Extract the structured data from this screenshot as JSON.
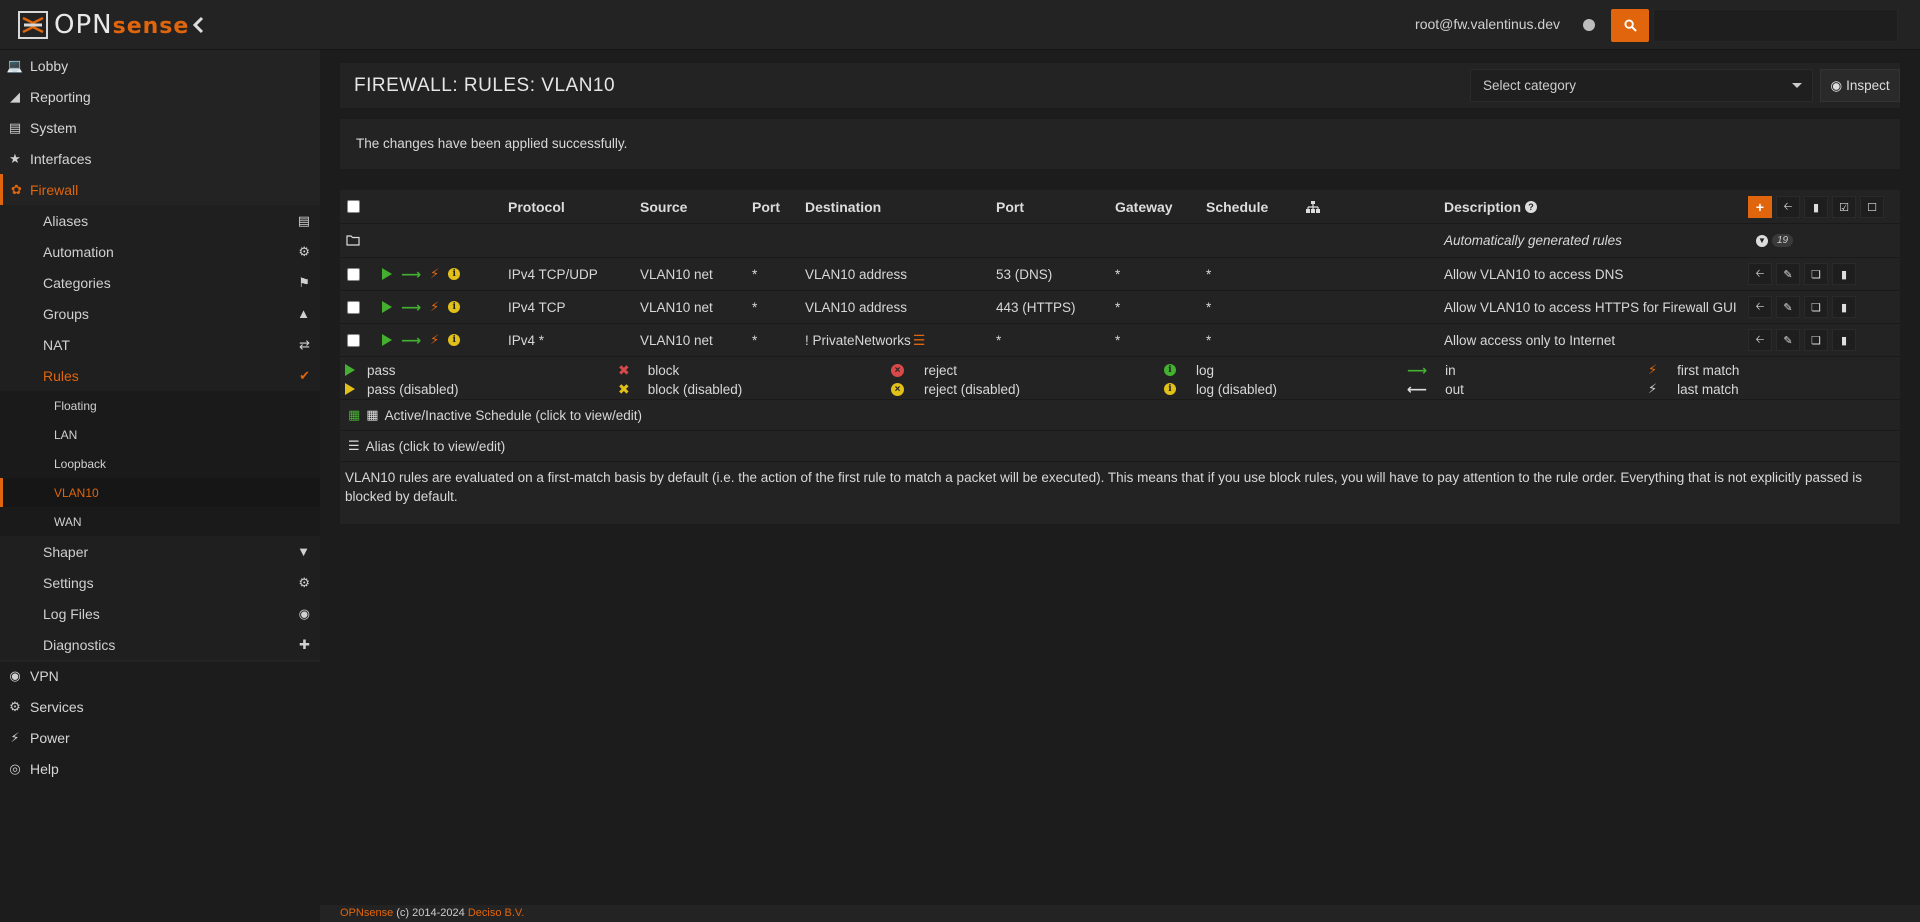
{
  "topbar": {
    "logo_main": "OPN",
    "logo_sub": "sense",
    "user": "root@fw.valentinus.dev",
    "search_placeholder": ""
  },
  "sidebar": {
    "items": [
      {
        "label": "Lobby",
        "icon": "laptop-icon"
      },
      {
        "label": "Reporting",
        "icon": "chart-area-icon"
      },
      {
        "label": "System",
        "icon": "server-icon"
      },
      {
        "label": "Interfaces",
        "icon": "sitemap-icon"
      },
      {
        "label": "Firewall",
        "icon": "fire-icon"
      }
    ],
    "firewall_sub": [
      {
        "label": "Aliases",
        "icon": "list-alt-icon"
      },
      {
        "label": "Automation",
        "icon": "cog-icon"
      },
      {
        "label": "Categories",
        "icon": "tags-icon"
      },
      {
        "label": "Groups",
        "icon": "sitemap-icon"
      },
      {
        "label": "NAT",
        "icon": "exchange-icon"
      },
      {
        "label": "Rules",
        "icon": "check-icon"
      }
    ],
    "rules_sub": [
      "Floating",
      "LAN",
      "Loopback",
      "VLAN10",
      "WAN"
    ],
    "firewall_sub2": [
      {
        "label": "Shaper",
        "icon": "filter-icon"
      },
      {
        "label": "Settings",
        "icon": "cogs-icon"
      },
      {
        "label": "Log Files",
        "icon": "eye-icon"
      },
      {
        "label": "Diagnostics",
        "icon": "medkit-icon"
      }
    ],
    "items2": [
      {
        "label": "VPN",
        "icon": "globe-icon"
      },
      {
        "label": "Services",
        "icon": "cog-icon"
      },
      {
        "label": "Power",
        "icon": "plug-icon"
      },
      {
        "label": "Help",
        "icon": "life-ring-icon"
      }
    ]
  },
  "main": {
    "title": "FIREWALL: RULES: VLAN10",
    "select_category": "Select category",
    "inspect": "Inspect",
    "alert": "The changes have been applied successfully."
  },
  "table": {
    "headers": {
      "protocol": "Protocol",
      "source": "Source",
      "port": "Port",
      "destination": "Destination",
      "dport": "Port",
      "gateway": "Gateway",
      "schedule": "Schedule",
      "description": "Description"
    },
    "auto_rules": {
      "label": "Automatically generated rules",
      "count": "19"
    },
    "rows": [
      {
        "protocol": "IPv4 TCP/UDP",
        "source": "VLAN10 net",
        "port": "*",
        "destination": "VLAN10 address",
        "dport": "53 (DNS)",
        "gateway": "*",
        "schedule": "*",
        "description": "Allow VLAN10 to access DNS"
      },
      {
        "protocol": "IPv4 TCP",
        "source": "VLAN10 net",
        "port": "*",
        "destination": "VLAN10 address",
        "dport": "443 (HTTPS)",
        "gateway": "*",
        "schedule": "*",
        "description": "Allow VLAN10 to access HTTPS for Firewall GUI"
      },
      {
        "protocol": "IPv4 *",
        "source": "VLAN10 net",
        "port": "*",
        "destination": "! PrivateNetworks",
        "dport": "*",
        "gateway": "*",
        "schedule": "*",
        "description": "Allow access only to Internet"
      }
    ]
  },
  "legend": {
    "pass": "pass",
    "pass_dis": "pass (disabled)",
    "block": "block",
    "block_dis": "block (disabled)",
    "reject": "reject",
    "reject_dis": "reject (disabled)",
    "log": "log",
    "log_dis": "log (disabled)",
    "in": "in",
    "out": "out",
    "first_match": "first match",
    "last_match": "last match",
    "schedule": "Active/Inactive Schedule (click to view/edit)",
    "alias": "Alias (click to view/edit)",
    "note": "VLAN10 rules are evaluated on a first-match basis by default (i.e. the action of the first rule to match a packet will be executed). This means that if you use block rules, you will have to pay attention to the rule order. Everything that is not explicitly passed is blocked by default."
  },
  "footer": {
    "brand": "OPNsense",
    "copy": " (c) 2014-2024 ",
    "company": "Deciso B.V."
  },
  "colors": {
    "accent": "#e0650c",
    "pass": "#44b030",
    "disabled": "#e2c01a",
    "block": "#d84a4a"
  }
}
